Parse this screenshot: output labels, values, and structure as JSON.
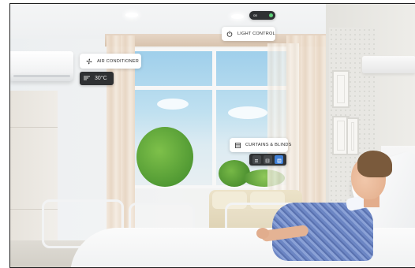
{
  "widgets": {
    "light_control": {
      "label": "LIGHT CONTROL",
      "icon": "power-icon",
      "toggle_text": "on",
      "toggle_state": true,
      "indicator_color": "#5fd27a"
    },
    "air_conditioner": {
      "label": "AIR CONDITIONER",
      "icon": "fan-icon",
      "temperature": "30°C"
    },
    "curtains_blinds": {
      "label": "CURTAINS & BLINDS",
      "icon": "curtain-icon",
      "buttons": [
        {
          "icon": "blind-close-icon",
          "active": false
        },
        {
          "icon": "blind-half-icon",
          "active": false
        },
        {
          "icon": "blind-open-icon",
          "active": true
        }
      ],
      "active_color": "#3f7fd6"
    }
  },
  "colors": {
    "chip_background": "#2f3133",
    "pill_background": "#ffffff",
    "accent_blue": "#3f7fd6",
    "status_green": "#5fd27a"
  }
}
